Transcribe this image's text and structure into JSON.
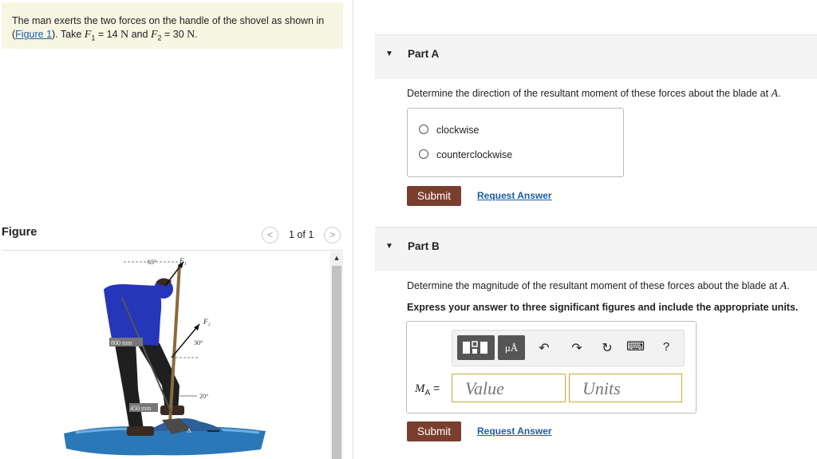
{
  "problem": {
    "intro": "The man exerts the two forces on the handle of the shovel as shown in",
    "paren_open": "(",
    "figure_link": "Figure 1",
    "after_link": "). Take ",
    "f1_sym": "F",
    "f1_sub": "1",
    "f1_eq": " = 14 ",
    "f1_unit": "N",
    "and": " and ",
    "f2_sym": "F",
    "f2_sub": "2",
    "f2_eq": " = 30 ",
    "f2_unit": "N",
    "end": "."
  },
  "figure": {
    "title": "Figure",
    "prev": "<",
    "next": ">",
    "counter": "1 of 1",
    "labels": {
      "angle65": "65°",
      "f1": "F₁",
      "f2": "F₂",
      "angle30": "30°",
      "dim800": "800 mm",
      "angle20": "20°",
      "dim450": "450 mm",
      "pointA": "A"
    }
  },
  "partA": {
    "caret": "▼",
    "title": "Part A",
    "question": "Determine the direction of the resultant moment of these forces about the blade at ",
    "point": "A",
    "period": ".",
    "choices": [
      "clockwise",
      "counterclockwise"
    ],
    "submit": "Submit",
    "request": "Request Answer"
  },
  "partB": {
    "caret": "▼",
    "title": "Part B",
    "question": "Determine the magnitude of the resultant moment of these forces about the blade at ",
    "point": "A",
    "period": ".",
    "instruction": "Express your answer to three significant figures and include the appropriate units.",
    "units_tool": "μÅ",
    "undo": "↶",
    "redo": "↷",
    "reset": "↻",
    "keyboard": "⌨",
    "help": "?",
    "label_sym": "M",
    "label_sub": "A",
    "label_eq": " = ",
    "value_placeholder": "Value",
    "units_placeholder": "Units",
    "submit": "Submit",
    "request": "Request Answer"
  },
  "colors": {
    "submit_bg": "#7a3e2e",
    "link": "#1a5ea8",
    "problem_bg": "#f6f6e3",
    "input_border": "#c9a93b",
    "shirt": "#2636b8",
    "ground": "#2a78b8"
  }
}
